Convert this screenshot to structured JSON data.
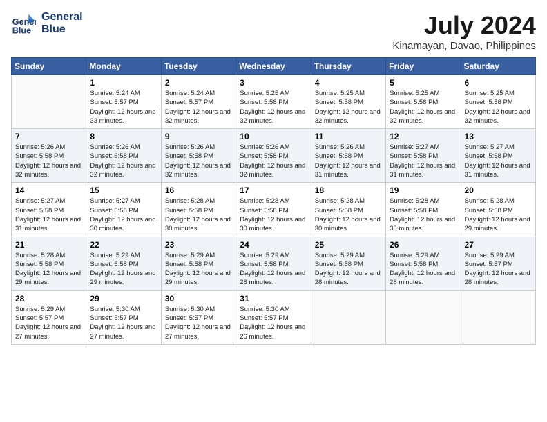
{
  "header": {
    "logo_line1": "General",
    "logo_line2": "Blue",
    "month_year": "July 2024",
    "location": "Kinamayan, Davao, Philippines"
  },
  "weekdays": [
    "Sunday",
    "Monday",
    "Tuesday",
    "Wednesday",
    "Thursday",
    "Friday",
    "Saturday"
  ],
  "weeks": [
    [
      {
        "day": "",
        "sunrise": "",
        "sunset": "",
        "daylight": ""
      },
      {
        "day": "1",
        "sunrise": "Sunrise: 5:24 AM",
        "sunset": "Sunset: 5:57 PM",
        "daylight": "Daylight: 12 hours and 33 minutes."
      },
      {
        "day": "2",
        "sunrise": "Sunrise: 5:24 AM",
        "sunset": "Sunset: 5:57 PM",
        "daylight": "Daylight: 12 hours and 32 minutes."
      },
      {
        "day": "3",
        "sunrise": "Sunrise: 5:25 AM",
        "sunset": "Sunset: 5:58 PM",
        "daylight": "Daylight: 12 hours and 32 minutes."
      },
      {
        "day": "4",
        "sunrise": "Sunrise: 5:25 AM",
        "sunset": "Sunset: 5:58 PM",
        "daylight": "Daylight: 12 hours and 32 minutes."
      },
      {
        "day": "5",
        "sunrise": "Sunrise: 5:25 AM",
        "sunset": "Sunset: 5:58 PM",
        "daylight": "Daylight: 12 hours and 32 minutes."
      },
      {
        "day": "6",
        "sunrise": "Sunrise: 5:25 AM",
        "sunset": "Sunset: 5:58 PM",
        "daylight": "Daylight: 12 hours and 32 minutes."
      }
    ],
    [
      {
        "day": "7",
        "sunrise": "Sunrise: 5:26 AM",
        "sunset": "Sunset: 5:58 PM",
        "daylight": "Daylight: 12 hours and 32 minutes."
      },
      {
        "day": "8",
        "sunrise": "Sunrise: 5:26 AM",
        "sunset": "Sunset: 5:58 PM",
        "daylight": "Daylight: 12 hours and 32 minutes."
      },
      {
        "day": "9",
        "sunrise": "Sunrise: 5:26 AM",
        "sunset": "Sunset: 5:58 PM",
        "daylight": "Daylight: 12 hours and 32 minutes."
      },
      {
        "day": "10",
        "sunrise": "Sunrise: 5:26 AM",
        "sunset": "Sunset: 5:58 PM",
        "daylight": "Daylight: 12 hours and 32 minutes."
      },
      {
        "day": "11",
        "sunrise": "Sunrise: 5:26 AM",
        "sunset": "Sunset: 5:58 PM",
        "daylight": "Daylight: 12 hours and 31 minutes."
      },
      {
        "day": "12",
        "sunrise": "Sunrise: 5:27 AM",
        "sunset": "Sunset: 5:58 PM",
        "daylight": "Daylight: 12 hours and 31 minutes."
      },
      {
        "day": "13",
        "sunrise": "Sunrise: 5:27 AM",
        "sunset": "Sunset: 5:58 PM",
        "daylight": "Daylight: 12 hours and 31 minutes."
      }
    ],
    [
      {
        "day": "14",
        "sunrise": "Sunrise: 5:27 AM",
        "sunset": "Sunset: 5:58 PM",
        "daylight": "Daylight: 12 hours and 31 minutes."
      },
      {
        "day": "15",
        "sunrise": "Sunrise: 5:27 AM",
        "sunset": "Sunset: 5:58 PM",
        "daylight": "Daylight: 12 hours and 30 minutes."
      },
      {
        "day": "16",
        "sunrise": "Sunrise: 5:28 AM",
        "sunset": "Sunset: 5:58 PM",
        "daylight": "Daylight: 12 hours and 30 minutes."
      },
      {
        "day": "17",
        "sunrise": "Sunrise: 5:28 AM",
        "sunset": "Sunset: 5:58 PM",
        "daylight": "Daylight: 12 hours and 30 minutes."
      },
      {
        "day": "18",
        "sunrise": "Sunrise: 5:28 AM",
        "sunset": "Sunset: 5:58 PM",
        "daylight": "Daylight: 12 hours and 30 minutes."
      },
      {
        "day": "19",
        "sunrise": "Sunrise: 5:28 AM",
        "sunset": "Sunset: 5:58 PM",
        "daylight": "Daylight: 12 hours and 30 minutes."
      },
      {
        "day": "20",
        "sunrise": "Sunrise: 5:28 AM",
        "sunset": "Sunset: 5:58 PM",
        "daylight": "Daylight: 12 hours and 29 minutes."
      }
    ],
    [
      {
        "day": "21",
        "sunrise": "Sunrise: 5:28 AM",
        "sunset": "Sunset: 5:58 PM",
        "daylight": "Daylight: 12 hours and 29 minutes."
      },
      {
        "day": "22",
        "sunrise": "Sunrise: 5:29 AM",
        "sunset": "Sunset: 5:58 PM",
        "daylight": "Daylight: 12 hours and 29 minutes."
      },
      {
        "day": "23",
        "sunrise": "Sunrise: 5:29 AM",
        "sunset": "Sunset: 5:58 PM",
        "daylight": "Daylight: 12 hours and 29 minutes."
      },
      {
        "day": "24",
        "sunrise": "Sunrise: 5:29 AM",
        "sunset": "Sunset: 5:58 PM",
        "daylight": "Daylight: 12 hours and 28 minutes."
      },
      {
        "day": "25",
        "sunrise": "Sunrise: 5:29 AM",
        "sunset": "Sunset: 5:58 PM",
        "daylight": "Daylight: 12 hours and 28 minutes."
      },
      {
        "day": "26",
        "sunrise": "Sunrise: 5:29 AM",
        "sunset": "Sunset: 5:58 PM",
        "daylight": "Daylight: 12 hours and 28 minutes."
      },
      {
        "day": "27",
        "sunrise": "Sunrise: 5:29 AM",
        "sunset": "Sunset: 5:57 PM",
        "daylight": "Daylight: 12 hours and 28 minutes."
      }
    ],
    [
      {
        "day": "28",
        "sunrise": "Sunrise: 5:29 AM",
        "sunset": "Sunset: 5:57 PM",
        "daylight": "Daylight: 12 hours and 27 minutes."
      },
      {
        "day": "29",
        "sunrise": "Sunrise: 5:30 AM",
        "sunset": "Sunset: 5:57 PM",
        "daylight": "Daylight: 12 hours and 27 minutes."
      },
      {
        "day": "30",
        "sunrise": "Sunrise: 5:30 AM",
        "sunset": "Sunset: 5:57 PM",
        "daylight": "Daylight: 12 hours and 27 minutes."
      },
      {
        "day": "31",
        "sunrise": "Sunrise: 5:30 AM",
        "sunset": "Sunset: 5:57 PM",
        "daylight": "Daylight: 12 hours and 26 minutes."
      },
      {
        "day": "",
        "sunrise": "",
        "sunset": "",
        "daylight": ""
      },
      {
        "day": "",
        "sunrise": "",
        "sunset": "",
        "daylight": ""
      },
      {
        "day": "",
        "sunrise": "",
        "sunset": "",
        "daylight": ""
      }
    ]
  ]
}
